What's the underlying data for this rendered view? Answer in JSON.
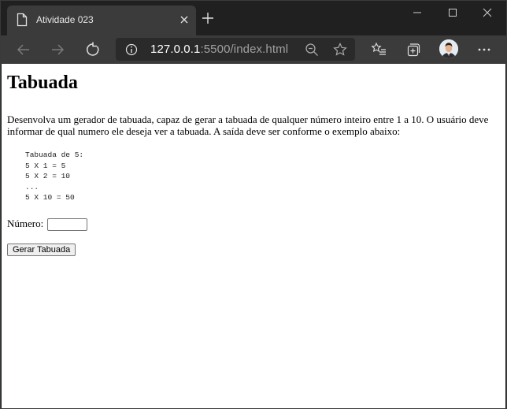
{
  "browser": {
    "tab_title": "Atividade 023",
    "url_host": "127.0.0.1",
    "url_rest": ":5500/index.html"
  },
  "page": {
    "heading": "Tabuada",
    "description": "Desenvolva um gerador de tabuada, capaz de gerar a tabuada de qualquer número inteiro entre 1 a 10. O usuário deve informar de qual numero ele deseja ver a tabuada. A saída deve ser conforme o exemplo abaixo:",
    "example": "Tabuada de 5:\n5 X 1 = 5\n5 X 2 = 10\n...\n5 X 10 = 50",
    "number_label": "Número:",
    "number_value": "",
    "button_label": "Gerar Tabuada"
  },
  "icons": {
    "tab": "page-icon",
    "tab_close": "close-icon",
    "new_tab": "plus-icon",
    "back": "back-arrow-icon",
    "forward": "forward-arrow-icon",
    "refresh": "refresh-icon",
    "info": "info-icon",
    "zoom": "zoom-out-icon",
    "favorite": "star-icon",
    "favorites": "favorites-list-icon",
    "collections": "collections-icon",
    "profile": "avatar",
    "menu": "more-icon"
  }
}
